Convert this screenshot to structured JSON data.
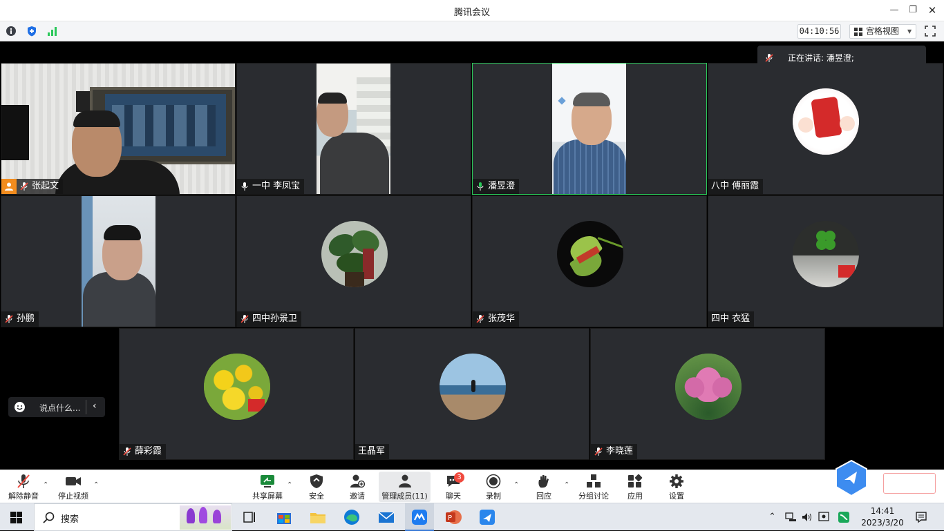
{
  "window": {
    "title": "腾讯会议"
  },
  "infobar": {
    "timer": "04:10:56",
    "view_label": "宫格视图"
  },
  "speaking": {
    "label": "正在讲话: 潘昱澄;"
  },
  "tiles": [
    {
      "name": "张起文"
    },
    {
      "name": "一中 李凤宝"
    },
    {
      "name": "潘昱澄"
    },
    {
      "name": "八中 傅丽霞"
    },
    {
      "name": "孙鹏"
    },
    {
      "name": "四中孙景卫"
    },
    {
      "name": "张茂华"
    },
    {
      "name": "四中 衣猛"
    },
    {
      "name": "薛彩霞"
    },
    {
      "name": "王晶军"
    },
    {
      "name": "李晓莲"
    }
  ],
  "chat": {
    "placeholder": "说点什么..."
  },
  "toolbar": {
    "unmute": "解除静音",
    "stop_video": "停止视频",
    "share": "共享屏幕",
    "security": "安全",
    "invite": "邀请",
    "members": "管理成员(11)",
    "chat": "聊天",
    "chat_badge": "3",
    "record": "录制",
    "react": "回应",
    "breakout": "分组讨论",
    "apps": "应用",
    "settings": "设置"
  },
  "taskbar": {
    "search": "搜索",
    "time": "14:41",
    "date": "2023/3/20"
  },
  "colors": {
    "accent": "#2bc85a",
    "tile_bg": "#2a2c30",
    "badge": "#f04a3e",
    "toolbar_bg": "#ffffff"
  }
}
